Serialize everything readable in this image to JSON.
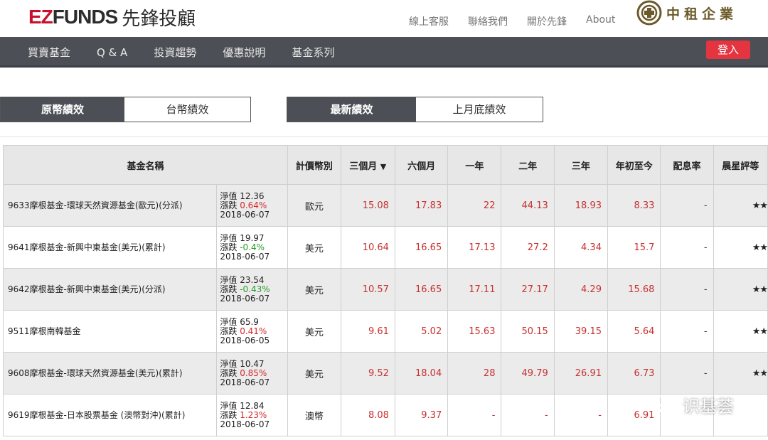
{
  "brand": {
    "logo_ez": "EZ",
    "logo_funds": "FUNDS",
    "logo_cn": "先鋒投顧"
  },
  "top_links": [
    "線上客服",
    "聯絡我們",
    "關於先鋒",
    "About"
  ],
  "company": {
    "name": "中租企業"
  },
  "nav": {
    "items": [
      "買賣基金",
      "Q & A",
      "投資趨勢",
      "優惠說明",
      "基金系列"
    ],
    "login": "登入"
  },
  "toggle_currency": {
    "active": "原幣績效",
    "inactive": "台幣績效"
  },
  "toggle_period": {
    "active": "最新績效",
    "inactive": "上月底績效"
  },
  "table": {
    "headers": {
      "name": "基金名稱",
      "currency": "計價幣別",
      "m3": "三個月",
      "m3_sort": "▼",
      "m6": "六個月",
      "y1": "一年",
      "y2": "二年",
      "y3": "三年",
      "ytd": "年初至今",
      "div": "配息率",
      "star": "晨星評等"
    },
    "rows": [
      {
        "name": "9633摩根基金-環球天然資源基金(歐元)(分派)",
        "nav": "淨值 12.36",
        "chg_label": "漲跌 ",
        "chg": "0.64%",
        "date": "2018-06-07",
        "currency": "歐元",
        "m3": "15.08",
        "m6": "17.83",
        "y1": "22",
        "y2": "44.13",
        "y3": "18.93",
        "ytd": "8.33",
        "div": "-",
        "star": "★★"
      },
      {
        "name": "9641摩根基金-新興中東基金(美元)(累計)",
        "nav": "淨值 19.97",
        "chg_label": "漲跌 ",
        "chg": "-0.4%",
        "date": "2018-06-07",
        "currency": "美元",
        "m3": "10.64",
        "m6": "16.65",
        "y1": "17.13",
        "y2": "27.2",
        "y3": "4.34",
        "ytd": "15.7",
        "div": "-",
        "star": "★★"
      },
      {
        "name": "9642摩根基金-新興中東基金(美元)(分派)",
        "nav": "淨值 23.54",
        "chg_label": "漲跌 ",
        "chg": "-0.43%",
        "date": "2018-06-07",
        "currency": "美元",
        "m3": "10.57",
        "m6": "16.65",
        "y1": "17.11",
        "y2": "27.17",
        "y3": "4.29",
        "ytd": "15.68",
        "div": "-",
        "star": "★★"
      },
      {
        "name": "9511摩根南韓基金",
        "nav": "淨值 65.9",
        "chg_label": "漲跌 ",
        "chg": "0.41%",
        "date": "2018-06-05",
        "currency": "美元",
        "m3": "9.61",
        "m6": "5.02",
        "y1": "15.63",
        "y2": "50.15",
        "y3": "39.15",
        "ytd": "5.64",
        "div": "-",
        "star": "★★"
      },
      {
        "name": "9608摩根基金-環球天然資源基金(美元)(累計)",
        "nav": "淨值 10.47",
        "chg_label": "漲跌 ",
        "chg": "0.85%",
        "date": "2018-06-07",
        "currency": "美元",
        "m3": "9.52",
        "m6": "18.04",
        "y1": "28",
        "y2": "49.79",
        "y3": "26.91",
        "ytd": "6.73",
        "div": "-",
        "star": "★★"
      },
      {
        "name": "9619摩根基金-日本股票基金 (澳幣對沖)(累計)",
        "nav": "淨值 12.84",
        "chg_label": "漲跌 ",
        "chg": "1.23%",
        "date": "2018-06-07",
        "currency": "澳幣",
        "m3": "8.08",
        "m6": "9.37",
        "y1": "-",
        "y2": "-",
        "y3": "-",
        "ytd": "6.91",
        "div": "",
        "star": ""
      }
    ]
  },
  "watermark": {
    "text": "识基荟"
  },
  "colors": {
    "brand_red": "#c8102e",
    "nav_bg": "#4c4f55",
    "login_red": "#e4343f",
    "gain_red": "#d42a2a",
    "loss_green": "#2a9a2a"
  }
}
